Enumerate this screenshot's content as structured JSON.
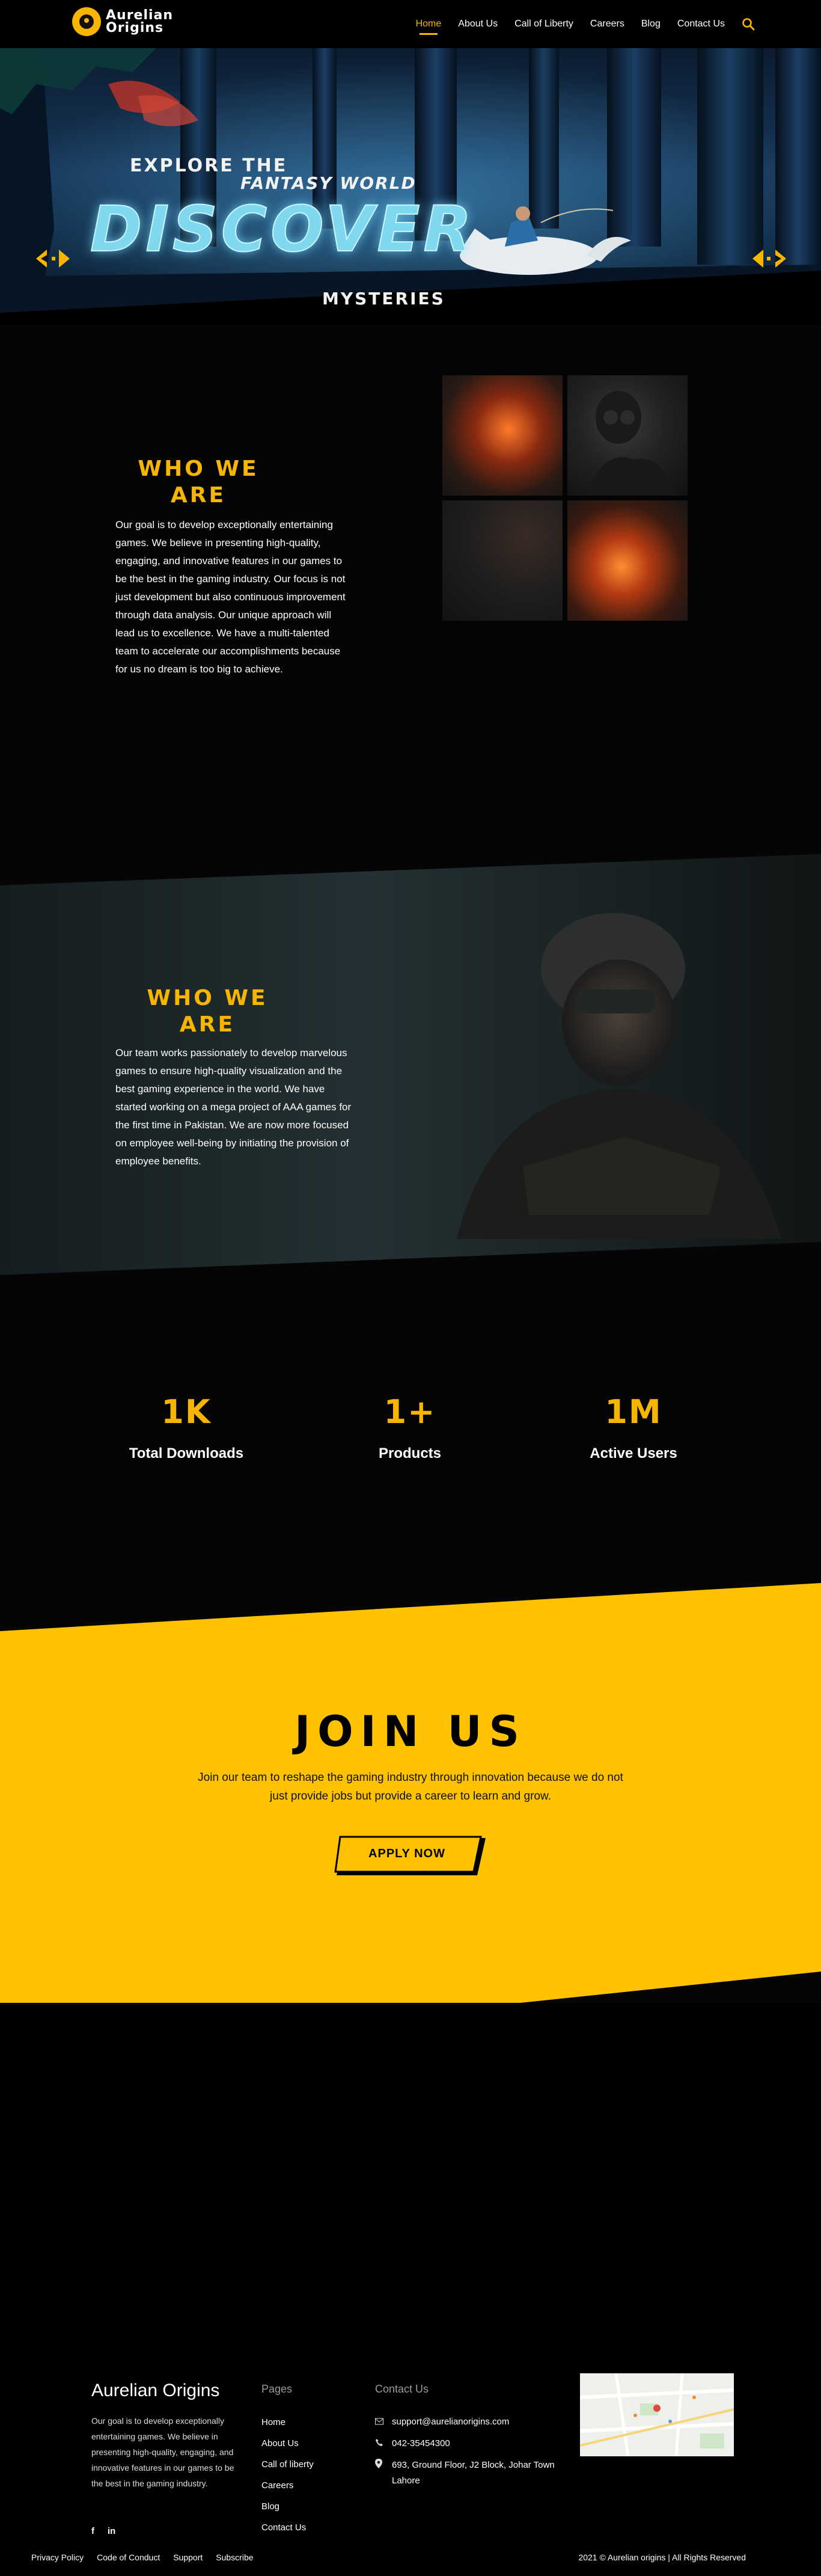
{
  "brand": {
    "line1": "Aurelian",
    "line2": "Origins"
  },
  "nav": {
    "items": [
      {
        "label": "Home",
        "active": true
      },
      {
        "label": "About Us"
      },
      {
        "label": "Call of Liberty"
      },
      {
        "label": "Careers"
      },
      {
        "label": "Blog"
      },
      {
        "label": "Contact Us"
      }
    ]
  },
  "hero": {
    "line1": "EXPLORE THE",
    "line2": "FANTASY WORLD",
    "big": "DISCOVER",
    "line3": "MYSTERIES"
  },
  "who1": {
    "title_line1": "WHO WE",
    "title_line2": "ARE",
    "text": "Our goal is to develop exceptionally entertaining games. We believe in presenting high-quality, engaging, and innovative features in our games to be the best in the gaming industry. Our focus is not just development but also continuous improvement through data analysis. Our unique approach will lead us to excellence. We have a multi-talented team to accelerate our accomplishments because for us no dream is too big to achieve."
  },
  "who2": {
    "title_line1": "WHO WE",
    "title_line2": "ARE",
    "text": "Our team works passionately to develop marvelous games to ensure high-quality visualization and the best gaming experience in the world. We have started working on a mega project of AAA games for the first time in Pakistan. We are now more focused on employee well-being by initiating the provision of employee benefits."
  },
  "stats": [
    {
      "value": "1K",
      "label": "Total Downloads"
    },
    {
      "value": "1+",
      "label": "Products"
    },
    {
      "value": "1M",
      "label": "Active Users"
    }
  ],
  "join": {
    "title": "JOIN US",
    "text": "Join our team to reshape the gaming industry through innovation because we do not just provide jobs but provide a career to learn and grow.",
    "button": "APPLY NOW"
  },
  "footer": {
    "brand": "Aurelian Origins",
    "about": "Our goal is to develop exceptionally entertaining games. We believe in presenting high-quality, engaging, and innovative features in our games to be the best in the gaming industry.",
    "pages_title": "Pages",
    "pages": [
      "Home",
      "About Us",
      "Call of liberty",
      "Careers",
      "Blog",
      "Contact Us"
    ],
    "contact_title": "Contact Us",
    "email": "support@aurelianorigins.com",
    "phone": "042-35454300",
    "address": "693, Ground Floor, J2 Block, Johar Town Lahore",
    "social": [
      "f",
      "in"
    ],
    "bottom_links": [
      "Privacy Policy",
      "Code of Conduct",
      "Support",
      "Subscribe"
    ],
    "copyright": "2021 © Aurelian origins | All Rights Reserved"
  },
  "colors": {
    "accent": "#f7b500",
    "background": "#050505",
    "join_band": "#ffc200"
  },
  "icons": {
    "search": "search-icon",
    "email": "envelope-icon",
    "phone": "phone-icon",
    "address": "map-pin-icon"
  }
}
